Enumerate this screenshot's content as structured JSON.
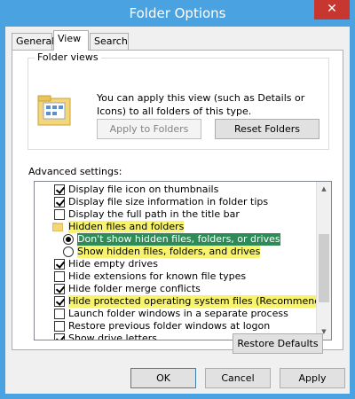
{
  "window": {
    "title": "Folder Options",
    "close_glyph": "✕"
  },
  "tabs": [
    {
      "label": "General"
    },
    {
      "label": "View"
    },
    {
      "label": "Search"
    }
  ],
  "folder_views": {
    "group_label": "Folder views",
    "description": "You can apply this view (such as Details or Icons) to all folders of this type.",
    "apply_button": "Apply to Folders",
    "reset_button": "Reset Folders",
    "icon": "folder-view-icon"
  },
  "advanced": {
    "label": "Advanced settings:",
    "items": [
      {
        "type": "checkbox",
        "checked": true,
        "label": "Display file icon on thumbnails",
        "highlight": false
      },
      {
        "type": "checkbox",
        "checked": true,
        "label": "Display file size information in folder tips",
        "highlight": false
      },
      {
        "type": "checkbox",
        "checked": false,
        "label": "Display the full path in the title bar",
        "highlight": false
      },
      {
        "type": "folder",
        "label": "Hidden files and folders",
        "highlight": true
      },
      {
        "type": "radio",
        "checked": true,
        "label": "Don't show hidden files, folders, or drives",
        "highlight": true,
        "selected": true
      },
      {
        "type": "radio",
        "checked": false,
        "label": "Show hidden files, folders, and drives",
        "highlight": true
      },
      {
        "type": "checkbox",
        "checked": true,
        "label": "Hide empty drives",
        "highlight": false
      },
      {
        "type": "checkbox",
        "checked": false,
        "label": "Hide extensions for known file types",
        "highlight": false
      },
      {
        "type": "checkbox",
        "checked": true,
        "label": "Hide folder merge conflicts",
        "highlight": false
      },
      {
        "type": "checkbox",
        "checked": true,
        "label": "Hide protected operating system files (Recommended)",
        "highlight": true
      },
      {
        "type": "checkbox",
        "checked": false,
        "label": "Launch folder windows in a separate process",
        "highlight": false
      },
      {
        "type": "checkbox",
        "checked": false,
        "label": "Restore previous folder windows at logon",
        "highlight": false
      },
      {
        "type": "checkbox",
        "checked": true,
        "label": "Show drive letters",
        "highlight": false
      }
    ]
  },
  "restore_defaults": "Restore Defaults",
  "footer": {
    "ok": "OK",
    "cancel": "Cancel",
    "apply": "Apply"
  },
  "colors": {
    "titlebar": "#4aa3e0",
    "close": "#c7372f",
    "highlight": "#f7f36c",
    "selection": "#2e8b57"
  }
}
